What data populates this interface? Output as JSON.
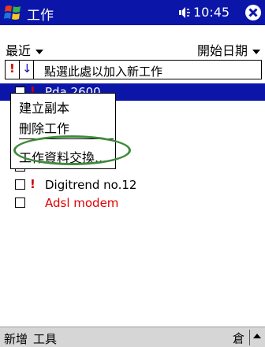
{
  "titlebar": {
    "app_title": "工作",
    "clock": "10:45",
    "start_icon": "windows-flag-icon",
    "volume_icon": "speaker-icon",
    "close_icon": "close-icon"
  },
  "filter": {
    "category": "最近",
    "sort_by": "開始日期"
  },
  "entry_bar": {
    "priority_symbol": "!",
    "arrow_symbol": "↓",
    "placeholder": "點選此處以加入新工作"
  },
  "tasks": [
    {
      "name": "Pda 2600",
      "priority": "!",
      "selected": true,
      "color": "#ffffff"
    },
    {
      "name": "",
      "priority": "",
      "selected": false,
      "color": "#000000"
    },
    {
      "name": "",
      "priority": "",
      "selected": false,
      "color": "#000000"
    },
    {
      "name": "",
      "priority": "",
      "selected": false,
      "color": "#000000"
    },
    {
      "name": "Digitrend no.12",
      "priority": "!",
      "selected": false,
      "color": "#000000"
    },
    {
      "name": "Adsl modem",
      "priority": "",
      "selected": false,
      "color": "#e00000"
    }
  ],
  "context_menu": {
    "items": [
      "建立副本",
      "刪除工作",
      "工作資料交換..."
    ]
  },
  "colors": {
    "titlebar_bg": "#0b16a8",
    "highlight_ring": "#3f8a3c",
    "priority_red": "#d00000"
  },
  "bottom_bar": {
    "new_label": "新增",
    "tools_label": "工具",
    "input_icon": "keyboard-icon",
    "input_glyph": "倉"
  }
}
